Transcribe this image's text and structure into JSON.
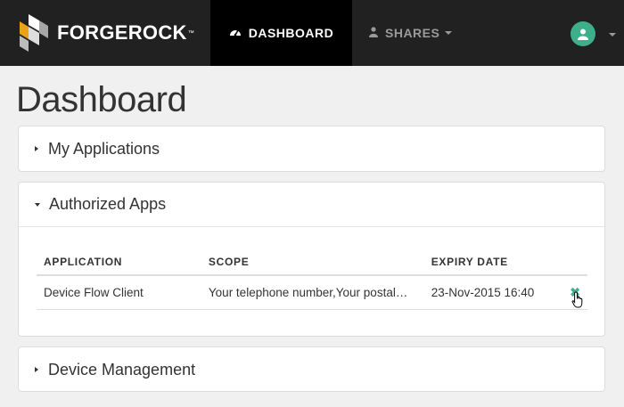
{
  "header": {
    "brand": "FORGEROCK",
    "brand_tm": "™",
    "nav": {
      "dashboard": "DASHBOARD",
      "shares": "SHARES"
    }
  },
  "page_title": "Dashboard",
  "panels": {
    "my_applications": "My Applications",
    "authorized_apps": "Authorized Apps",
    "device_management": "Device Management"
  },
  "table": {
    "columns": [
      "APPLICATION",
      "SCOPE",
      "EXPIRY DATE"
    ],
    "rows": [
      {
        "application": "Device Flow Client",
        "scope": "Your telephone number,Your postal…",
        "expiry": "23-Nov-2015 16:40",
        "action_icon": "✖"
      }
    ]
  },
  "icons": {
    "dashboard": "tachometer-icon",
    "shares": "user-icon",
    "avatar": "user-icon",
    "revoke": "close-icon"
  },
  "colors": {
    "nav_bg": "#212121",
    "nav_active": "#000000",
    "accent": "#3fae8a",
    "page_bg": "#f0f0f0"
  }
}
